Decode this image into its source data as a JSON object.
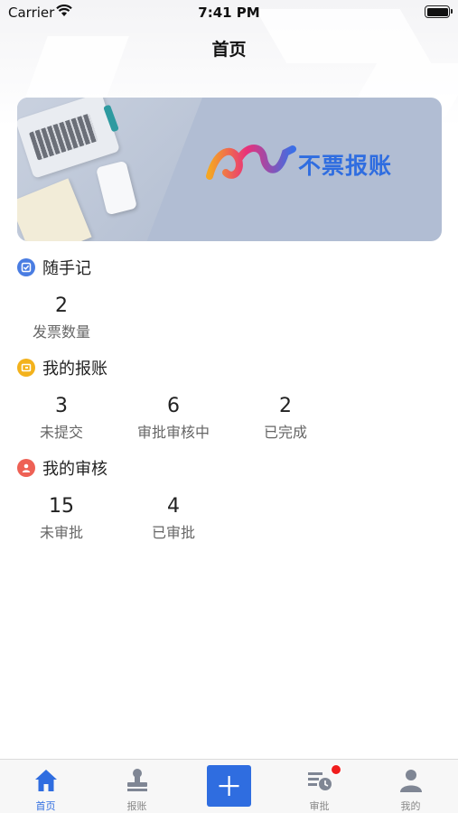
{
  "status_bar": {
    "carrier": "Carrier",
    "time": "7:41 PM"
  },
  "nav": {
    "title": "首页"
  },
  "banner": {
    "brand_text": "不票报账"
  },
  "sections": {
    "notes": {
      "title": "随手记",
      "icon": "checkbox-icon",
      "color": "#4a7de2",
      "stats": [
        {
          "value": "2",
          "label": "发票数量"
        }
      ]
    },
    "reimburse": {
      "title": "我的报账",
      "icon": "wallet-icon",
      "color": "#f3b21c",
      "stats": [
        {
          "value": "3",
          "label": "未提交"
        },
        {
          "value": "6",
          "label": "审批审核中"
        },
        {
          "value": "2",
          "label": "已完成"
        }
      ]
    },
    "review": {
      "title": "我的审核",
      "icon": "user-icon",
      "color": "#ee6155",
      "stats": [
        {
          "value": "15",
          "label": "未审批"
        },
        {
          "value": "4",
          "label": "已审批"
        }
      ]
    }
  },
  "tabbar": {
    "accent": "#2f6de0",
    "items": [
      {
        "label": "首页",
        "icon": "home-icon",
        "active": true
      },
      {
        "label": "报账",
        "icon": "stamp-icon",
        "active": false
      },
      {
        "label": "",
        "icon": "plus-icon",
        "active": false
      },
      {
        "label": "审批",
        "icon": "approval-list-icon",
        "active": false,
        "badge": true
      },
      {
        "label": "我的",
        "icon": "person-icon",
        "active": false
      }
    ]
  }
}
